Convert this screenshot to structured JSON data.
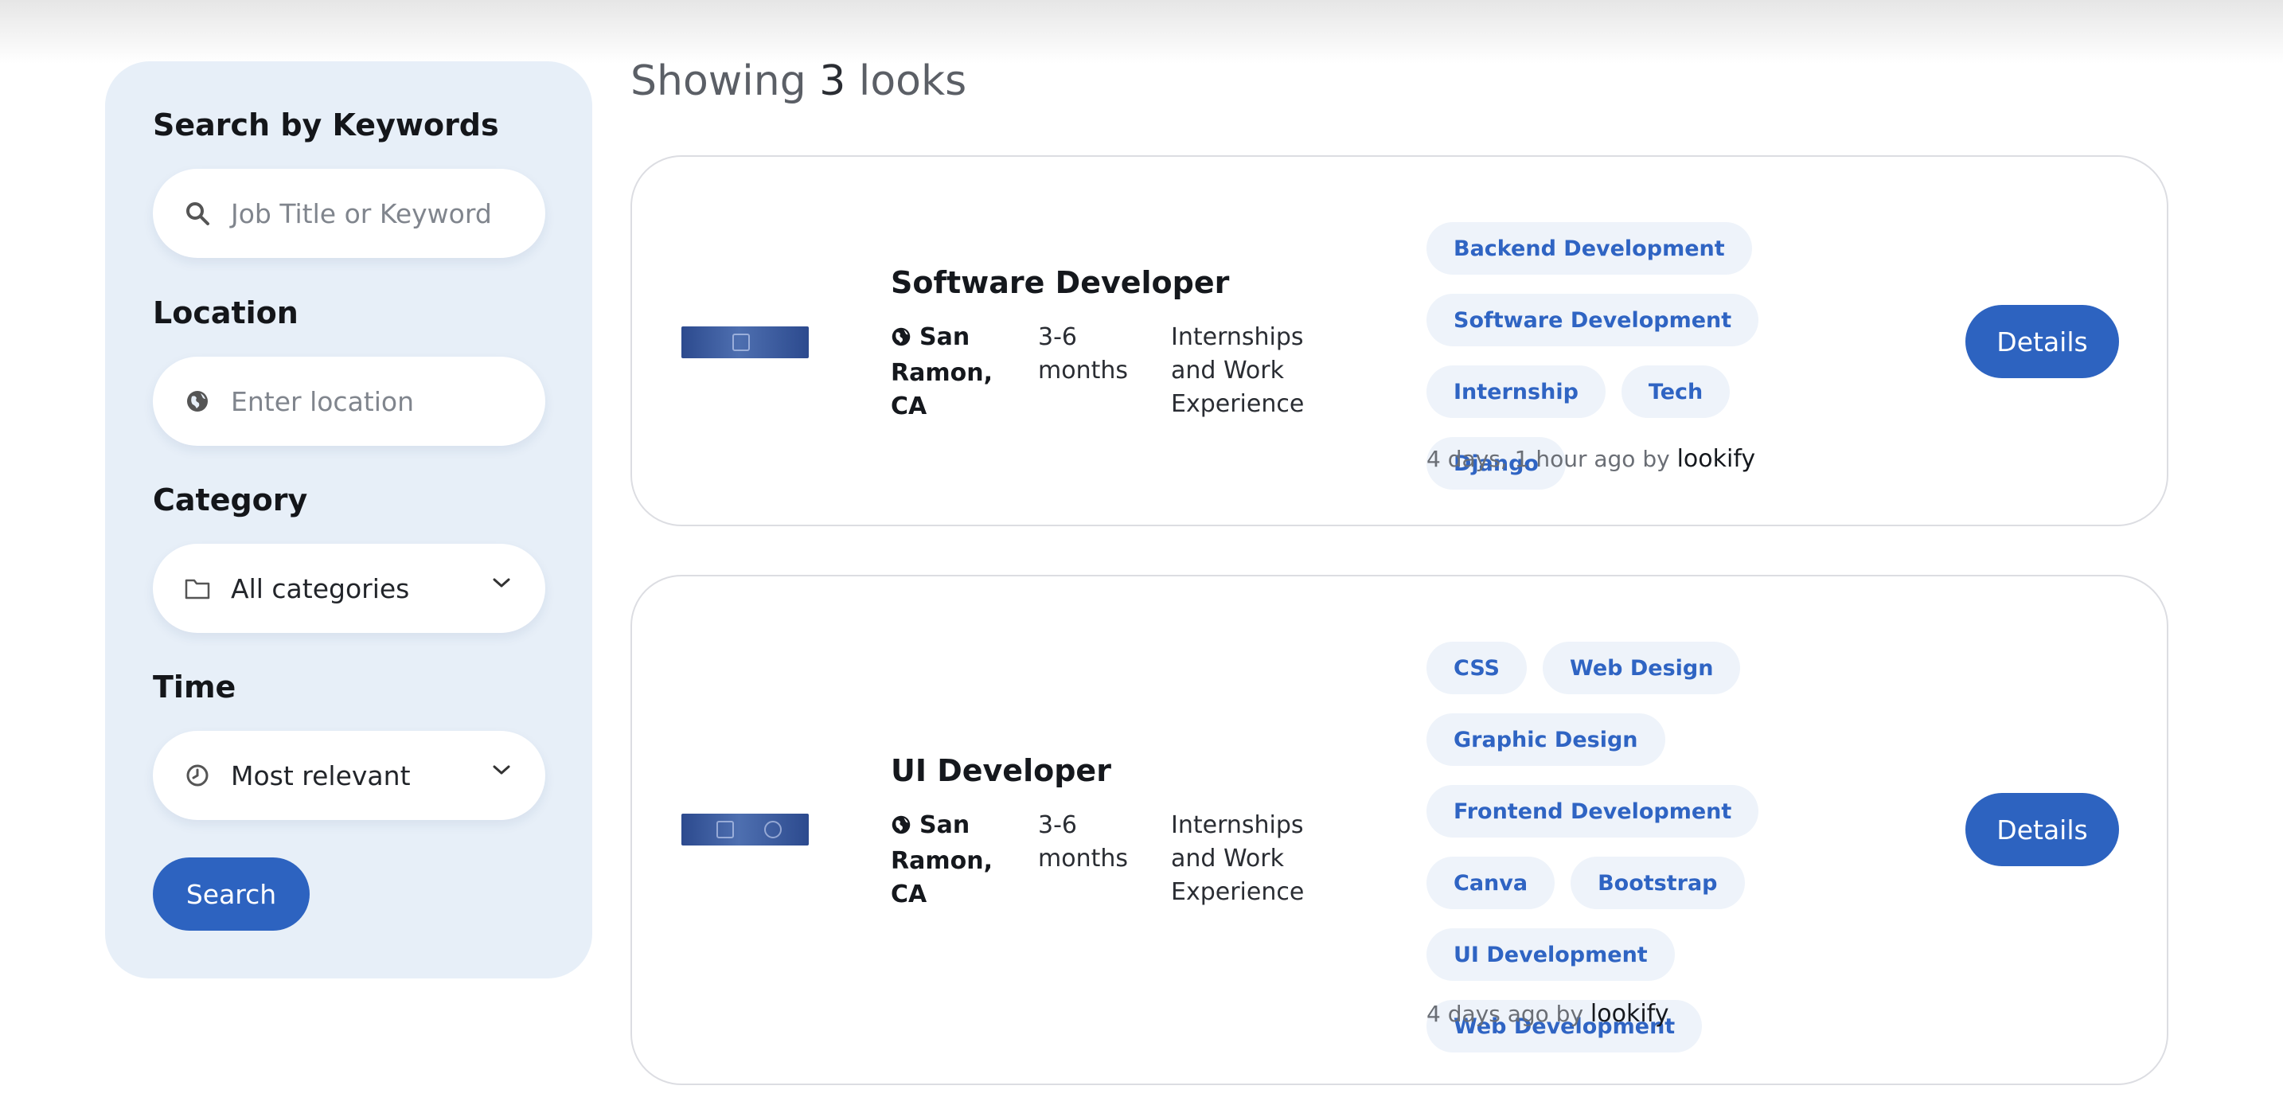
{
  "sidebar": {
    "keywords_label": "Search by Keywords",
    "keywords_placeholder": "Job Title or Keyword",
    "location_label": "Location",
    "location_placeholder": "Enter location",
    "category_label": "Category",
    "category_value": "All categories",
    "time_label": "Time",
    "time_value": "Most relevant",
    "search_button": "Search"
  },
  "results": {
    "prefix": "Showing",
    "count": "3",
    "suffix": "looks"
  },
  "jobs": [
    {
      "title": "Software Developer",
      "location": "San Ramon, CA",
      "duration": "3-6 months",
      "type": "Internships and Work Experience",
      "tags": [
        "Backend Development",
        "Software Development",
        "Internship",
        "Tech",
        "Django"
      ],
      "posted": "4 days, 1 hour ago by",
      "author": "lookify",
      "details_button": "Details"
    },
    {
      "title": "UI Developer",
      "location": "San Ramon, CA",
      "duration": "3-6 months",
      "type": "Internships and Work Experience",
      "tags": [
        "CSS",
        "Web Design",
        "Graphic Design",
        "Frontend Development",
        "Canva",
        "Bootstrap",
        "UI Development",
        "Web Development"
      ],
      "posted": "4 days ago by",
      "author": "lookify",
      "details_button": "Details"
    }
  ],
  "colors": {
    "accent": "#2d63c0",
    "sidebar_bg": "#e7eff8",
    "tag_bg": "#eef3fa"
  },
  "icons": [
    "search-icon",
    "globe-icon",
    "folder-icon",
    "clock-icon",
    "chevron-down-icon"
  ]
}
